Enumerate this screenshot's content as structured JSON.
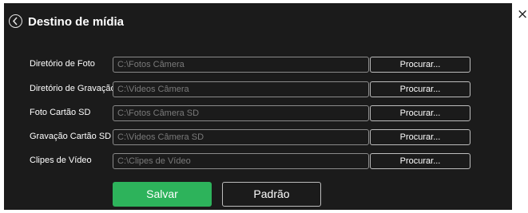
{
  "dialog": {
    "title": "Destino de mídia",
    "close_glyph": "×"
  },
  "rows": [
    {
      "label": "Diretório de Foto",
      "path": "C:\\Fotos Câmera",
      "button": "Procurar..."
    },
    {
      "label": "Diretório de Gravação",
      "path": "C:\\Videos Câmera",
      "button": "Procurar..."
    },
    {
      "label": "Foto Cartão SD",
      "path": "C:\\Fotos Câmera SD",
      "button": "Procurar..."
    },
    {
      "label": "Gravação Cartão SD",
      "path": "C:\\Videos Câmera SD",
      "button": "Procurar..."
    },
    {
      "label": "Clipes de Vídeo",
      "path": "C:\\Clipes de Vídeo",
      "button": "Procurar..."
    }
  ],
  "actions": {
    "save_label": "Salvar",
    "default_label": "Padrão"
  },
  "icons": {
    "back": "chevron-left-circle-icon",
    "close": "close-icon"
  },
  "colors": {
    "panel_bg": "#1b1b1b",
    "accent_green": "#2db35b",
    "text": "#ffffff",
    "input_text": "#7a7a7a"
  }
}
